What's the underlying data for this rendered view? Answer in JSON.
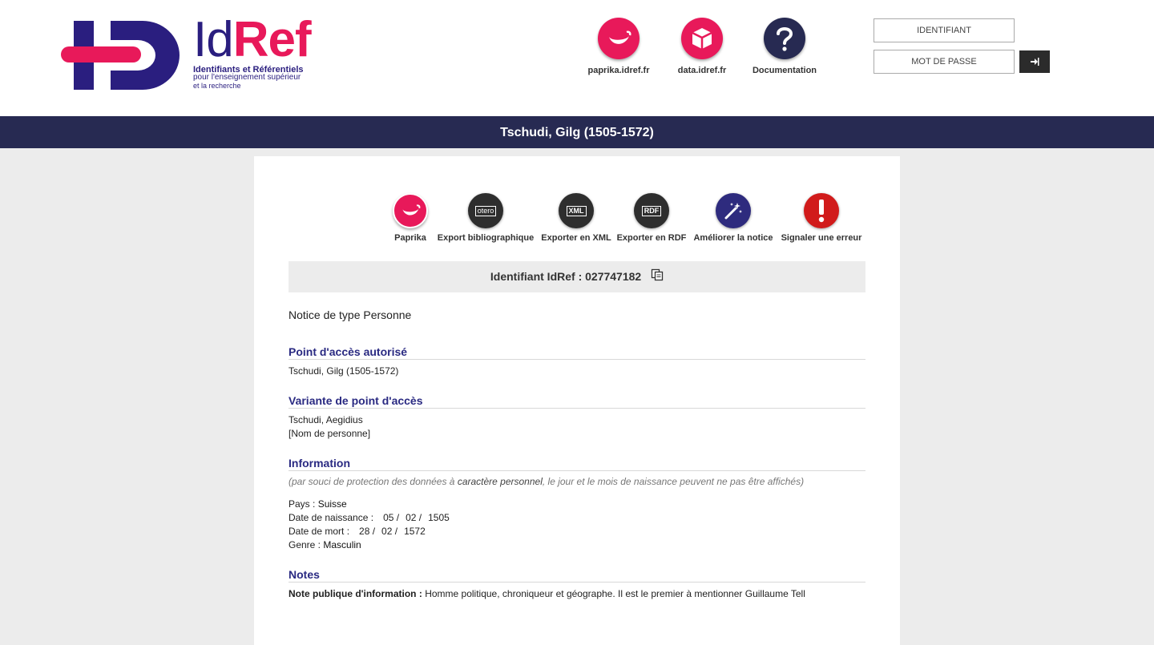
{
  "header": {
    "logo": {
      "word_id": "Id",
      "word_ref": "Ref",
      "sub1": "Identifiants et Référentiels",
      "sub2": "pour l'enseignement supérieur",
      "sub3": "et la recherche"
    },
    "links": [
      {
        "label": "paprika.idref.fr",
        "icon": "paprika-icon"
      },
      {
        "label": "data.idref.fr",
        "icon": "cube-icon"
      },
      {
        "label": "Documentation",
        "icon": "question-icon"
      }
    ],
    "login": {
      "identifiant": "IDENTIFIANT",
      "password": "MOT DE PASSE"
    }
  },
  "page_title": "Tschudi, Gilg (1505-1572)",
  "actions": [
    {
      "label": "Paprika",
      "icon": "paprika-icon"
    },
    {
      "label": "Export bibliographique",
      "icon": "zotero-icon",
      "icon_text": "otero"
    },
    {
      "label": "Exporter en XML",
      "icon": "xml-icon",
      "icon_text": "XML"
    },
    {
      "label": "Exporter en RDF",
      "icon": "rdf-icon",
      "icon_text": "RDF"
    },
    {
      "label": "Améliorer la notice",
      "icon": "magic-wand-icon"
    },
    {
      "label": "Signaler une erreur",
      "icon": "exclamation-icon"
    }
  ],
  "identifier": {
    "label": "Identifiant IdRef :",
    "value": "027747182"
  },
  "record": {
    "type": "Notice de type Personne",
    "authorized_heading": {
      "title": "Point d'accès autorisé",
      "value": "Tschudi, Gilg (1505-1572)"
    },
    "variant": {
      "title": "Variante de point d'accès",
      "value": "Tschudi, Aegidius",
      "note": "[Nom de personne]"
    },
    "information": {
      "title": "Information",
      "privacy_pre": "(par souci de protection des données à ",
      "privacy_em": "caractère personnel",
      "privacy_post": ", le jour et le mois de naissance peuvent ne pas être affichés)",
      "country_label": "Pays :",
      "country": "Suisse",
      "birth_label": "Date de naissance :",
      "birth": [
        "05 /",
        "02 /",
        "1505"
      ],
      "death_label": "Date de mort :",
      "death": [
        "28 /",
        "02 /",
        "1572"
      ],
      "gender_label": "Genre :",
      "gender": "Masculin"
    },
    "notes": {
      "title": "Notes",
      "label": "Note publique d'information :",
      "text": "Homme politique, chroniqueur et géographe. Il est le premier à mentionner Guillaume Tell"
    }
  },
  "colors": {
    "navy": "#272a52",
    "pink": "#e8195a",
    "indigo": "#2a1e7f",
    "error_red": "#d11b1b",
    "section_blue": "#2a2a82"
  }
}
